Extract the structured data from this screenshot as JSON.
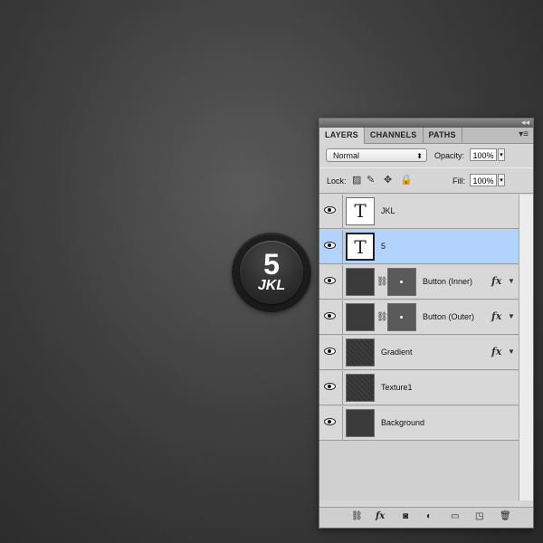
{
  "canvas": {
    "button_number": "5",
    "button_letters": "JKL"
  },
  "panel": {
    "tabs": [
      {
        "label": "LAYERS",
        "active": true
      },
      {
        "label": "CHANNELS",
        "active": false
      },
      {
        "label": "PATHS",
        "active": false
      }
    ],
    "blend_mode": "Normal",
    "opacity_label": "Opacity:",
    "opacity_value": "100%",
    "lock_label": "Lock:",
    "fill_label": "Fill:",
    "fill_value": "100%"
  },
  "layers": [
    {
      "name": "JKL",
      "thumb": "text",
      "selected": false,
      "fx": false
    },
    {
      "name": "5",
      "thumb": "text",
      "selected": true,
      "fx": false
    },
    {
      "name": "Button (Inner)",
      "thumb": "dark-mask",
      "selected": false,
      "fx": true
    },
    {
      "name": "Button (Outer)",
      "thumb": "dark-mask",
      "selected": false,
      "fx": true
    },
    {
      "name": "Gradient",
      "thumb": "texture",
      "selected": false,
      "fx": true
    },
    {
      "name": "Texture1",
      "thumb": "texture",
      "selected": false,
      "fx": false
    },
    {
      "name": "Background",
      "thumb": "dark",
      "selected": false,
      "fx": false
    }
  ],
  "icons": {
    "eye": "eye-icon",
    "text_thumb": "T",
    "fx": "fx",
    "link": "link-icon"
  },
  "colors": {
    "selected_row": "#b1d3fd",
    "panel_bg": "#d6d6d6"
  }
}
